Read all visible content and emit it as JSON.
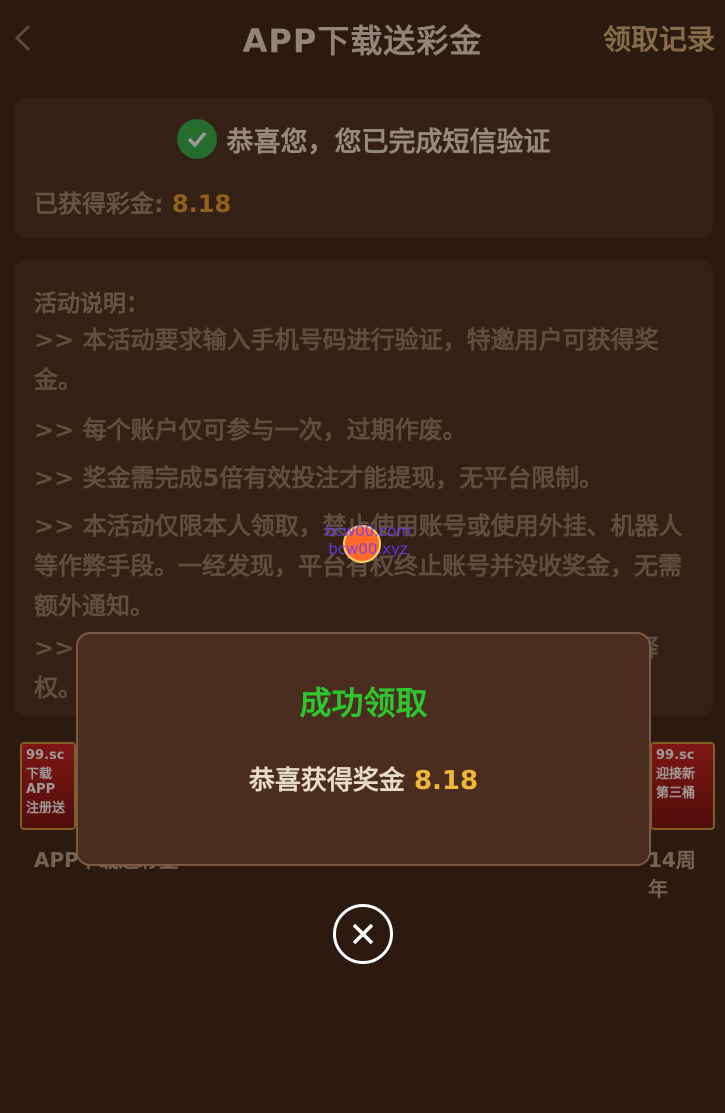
{
  "header": {
    "title": "APP下载送彩金",
    "records_label": "领取记录",
    "back_icon": "chevron-left-icon"
  },
  "verify_card": {
    "message": "恭喜您，您已完成短信验证",
    "earned_label": "已获得彩金:",
    "earned_amount": "8.18",
    "check_icon": "check-circle-icon"
  },
  "rules": {
    "title": "活动说明：",
    "items": [
      ">> 本活动要求输入手机号码进行验证，特邀用户可获得奖金。",
      ">> 每个账户仅可参与一次，过期作废。",
      ">> 奖金需完成5倍有效投注才能提现，无平台限制。",
      ">> 本活动仅限本人领取，禁止使用账号或使用外挂、机器人等作弊手段。一经发现，平台有权终止账号并没收奖金，无需额外通知。",
      ">> 本活动最终解释权归平台所有，平台保留活动最终解释权。"
    ]
  },
  "banners": {
    "left_text": "下载APP 注册送",
    "right_text": "迎接新 第三桶",
    "brand_badge": "99.sc",
    "left_caption": "APP下载送彩金",
    "right_caption": "14周年"
  },
  "watermark": {
    "line1": "bcw00.com",
    "line2": "bcw00.xyz"
  },
  "modal": {
    "title": "成功领取",
    "message_prefix": "恭喜获得奖金",
    "amount": "8.18",
    "close_icon": "close-circle-icon"
  },
  "colors": {
    "accent_gold": "#e7a12a",
    "success_green": "#2ec62e",
    "background": "#2a1810"
  }
}
